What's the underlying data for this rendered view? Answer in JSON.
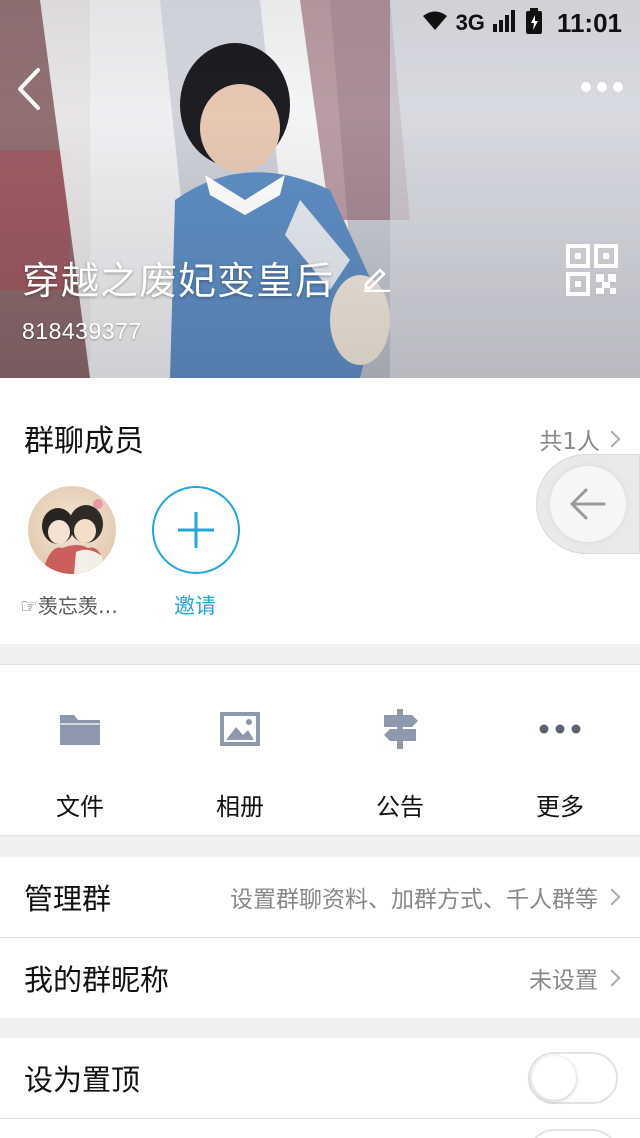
{
  "statusbar": {
    "network": "3G",
    "time": "11:01"
  },
  "group": {
    "name": "穿越之废妃变皇后",
    "id": "818439377"
  },
  "members": {
    "title": "群聊成员",
    "count": "共1人",
    "list": [
      {
        "name": "☞羡忘羡…"
      }
    ],
    "invite_label": "邀请"
  },
  "actions": [
    {
      "label": "文件",
      "icon": "folder-icon"
    },
    {
      "label": "相册",
      "icon": "image-icon"
    },
    {
      "label": "公告",
      "icon": "signpost-icon"
    },
    {
      "label": "更多",
      "icon": "more-dots-icon"
    }
  ],
  "settings": {
    "manage": {
      "label": "管理群",
      "value": "设置群聊资料、加群方式、千人群等"
    },
    "nickname": {
      "label": "我的群昵称",
      "value": "未设置"
    },
    "pin": {
      "label": "设为置顶",
      "enabled": false
    }
  },
  "colors": {
    "accent": "#23a6d9",
    "icon_gray": "#8e98ad"
  }
}
